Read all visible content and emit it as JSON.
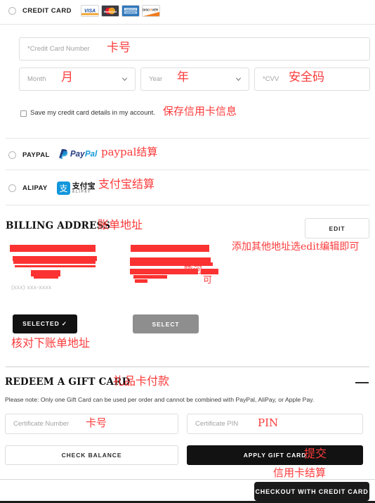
{
  "payment_methods": [
    {
      "id": "credit-card",
      "label": "CREDIT CARD",
      "selected": false,
      "brands": [
        "visa-logo",
        "mastercard-logo",
        "amex-logo",
        "discover-logo"
      ]
    },
    {
      "id": "paypal",
      "label": "PAYPAL",
      "selected": false,
      "logo_text": "PayPal",
      "annotation": "paypal结算"
    },
    {
      "id": "alipay",
      "label": "ALIPAY",
      "selected": false,
      "logo_text": "支付宝",
      "logo_sub": "ALIPAY",
      "annotation": "支付宝结算"
    }
  ],
  "credit_card_form": {
    "card_number_placeholder": "*Credit Card Number",
    "card_number_annotation": "卡号",
    "month_placeholder": "Month",
    "month_annotation": "月",
    "year_placeholder": "Year",
    "year_annotation": "年",
    "cvv_placeholder": "*CVV",
    "cvv_annotation": "安全码",
    "save_card_label": "Save my credit card details in my account.",
    "save_card_annotation": "保存信用卡信息",
    "save_card_checked": false
  },
  "billing_address": {
    "title": "BILLING ADDRESS",
    "title_annotation": "账单地址",
    "edit_button": "EDIT",
    "edit_annotation": "添加其他地址选edit编辑即可",
    "phone_ghost": "(xxx) xxx-xxxx",
    "selected_button": "SELECTED ✓",
    "select_button": "SELECT",
    "verify_annotation": "核对下账单地址"
  },
  "gift_card": {
    "title": "REDEEM A GIFT CARD",
    "title_annotation": "礼品卡付款",
    "note": "Please note: Only one Gift Card can be used per order and cannot be combined with PayPal, AliPay, or Apple Pay.",
    "certificate_number_placeholder": "Certificate Number",
    "certificate_number_annotation": "卡号",
    "certificate_pin_placeholder": "Certificate PIN",
    "certificate_pin_annotation": "PIN",
    "check_balance_button": "CHECK BALANCE",
    "apply_button": "APPLY GIFT CARD",
    "apply_annotation": "提交",
    "collapse_icon": "minus-icon"
  },
  "checkout": {
    "button_label": "CHECKOUT WITH CREDIT CARD",
    "annotation": "信用卡结算"
  },
  "colors": {
    "annotation_red": "#fb3b3b",
    "redaction_red": "#fb3232",
    "dark_button": "#121212",
    "gray_button": "#8e8e8e"
  }
}
